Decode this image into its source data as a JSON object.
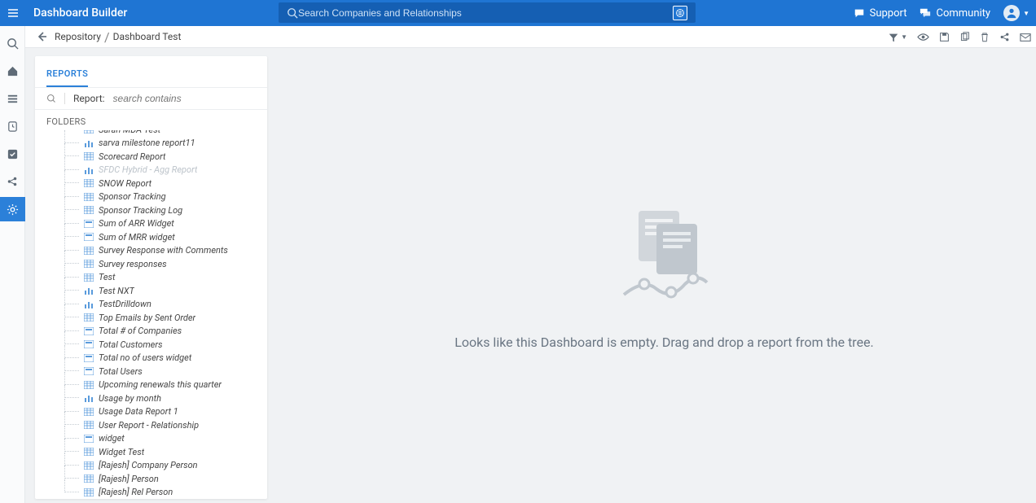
{
  "app": {
    "title": "Dashboard Builder"
  },
  "search": {
    "placeholder": "Search Companies and Relationships"
  },
  "top_links": {
    "support": "Support",
    "community": "Community"
  },
  "breadcrumb": {
    "root": "Repository",
    "current": "Dashboard Test"
  },
  "panel": {
    "tab": "REPORTS",
    "search_label": "Report:",
    "search_placeholder": "search contains",
    "folders_label": "FOLDERS"
  },
  "empty_state": {
    "message": "Looks like this Dashboard is empty. Drag and drop a report from the tree."
  },
  "reports": [
    {
      "icon": "table",
      "label": "Sarah MDA Test"
    },
    {
      "icon": "chart",
      "label": "sarva milestone report11"
    },
    {
      "icon": "table",
      "label": "Scorecard Report"
    },
    {
      "icon": "chart",
      "label": "SFDC Hybrid - Agg Report",
      "disabled": true
    },
    {
      "icon": "table",
      "label": "SNOW Report"
    },
    {
      "icon": "table",
      "label": "Sponsor Tracking"
    },
    {
      "icon": "table",
      "label": "Sponsor Tracking Log"
    },
    {
      "icon": "widget",
      "label": "Sum of ARR Widget"
    },
    {
      "icon": "widget",
      "label": "Sum of MRR widget"
    },
    {
      "icon": "table",
      "label": "Survey Response with Comments"
    },
    {
      "icon": "table",
      "label": "Survey responses"
    },
    {
      "icon": "table",
      "label": "Test"
    },
    {
      "icon": "chart",
      "label": "Test NXT"
    },
    {
      "icon": "chart",
      "label": "TestDrilldown"
    },
    {
      "icon": "table",
      "label": "Top Emails by Sent Order"
    },
    {
      "icon": "widget",
      "label": "Total # of Companies"
    },
    {
      "icon": "widget",
      "label": "Total Customers"
    },
    {
      "icon": "widget",
      "label": "Total no of users widget"
    },
    {
      "icon": "widget",
      "label": "Total Users"
    },
    {
      "icon": "table",
      "label": "Upcoming renewals this quarter"
    },
    {
      "icon": "chart",
      "label": "Usage by month"
    },
    {
      "icon": "table",
      "label": "Usage Data Report 1"
    },
    {
      "icon": "table",
      "label": "User Report - Relationship"
    },
    {
      "icon": "widget",
      "label": "widget"
    },
    {
      "icon": "table",
      "label": "Widget Test"
    },
    {
      "icon": "table",
      "label": "[Rajesh] Company Person"
    },
    {
      "icon": "table",
      "label": "[Rajesh] Person"
    },
    {
      "icon": "table",
      "label": "[Rajesh] Rel Person"
    }
  ],
  "icons": {
    "table": "table-icon",
    "chart": "bar-chart-icon",
    "widget": "widget-card-icon"
  }
}
